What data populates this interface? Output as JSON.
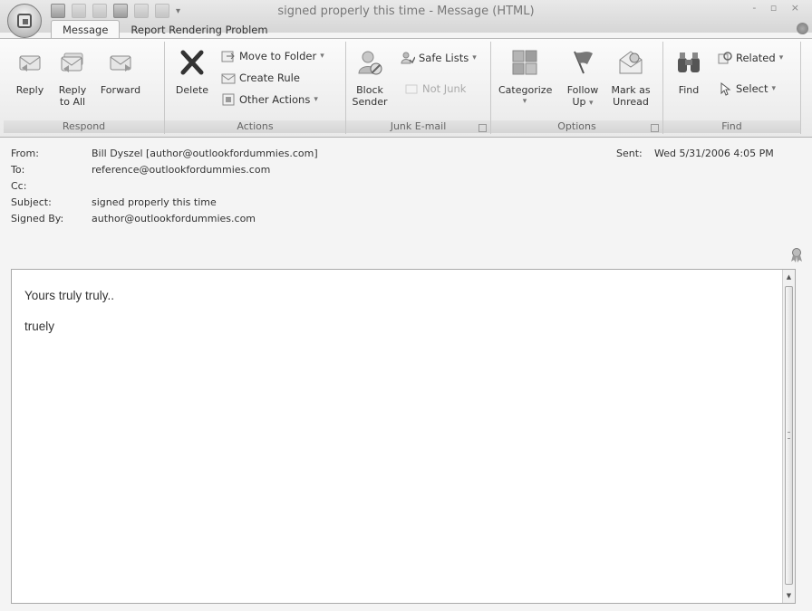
{
  "window": {
    "title": "signed properly this time - Message (HTML)",
    "controls": "- ▫ ×"
  },
  "tabs": [
    {
      "label": "Message"
    },
    {
      "label": "Report Rendering Problem"
    }
  ],
  "ribbon": {
    "respond": {
      "label": "Respond",
      "reply": "Reply",
      "reply_all_1": "Reply",
      "reply_all_2": "to All",
      "forward": "Forward"
    },
    "actions": {
      "label": "Actions",
      "delete": "Delete",
      "move_to_folder": "Move to Folder",
      "create_rule": "Create Rule",
      "other_actions": "Other Actions"
    },
    "junk": {
      "label": "Junk E-mail",
      "block_sender_1": "Block",
      "block_sender_2": "Sender",
      "safe_lists": "Safe Lists",
      "not_junk": "Not Junk"
    },
    "options": {
      "label": "Options",
      "categorize": "Categorize",
      "follow_up_1": "Follow",
      "follow_up_2": "Up",
      "mark_unread_1": "Mark as",
      "mark_unread_2": "Unread"
    },
    "find": {
      "label": "Find",
      "find": "Find",
      "related": "Related",
      "select": "Select"
    }
  },
  "header": {
    "from_label": "From:",
    "from": "Bill Dyszel [author@outlookfordummies.com]",
    "to_label": "To:",
    "to": "reference@outlookfordummies.com",
    "cc_label": "Cc:",
    "cc": "",
    "subject_label": "Subject:",
    "subject": "signed properly this time",
    "signed_by_label": "Signed By:",
    "signed_by": "author@outlookfordummies.com",
    "sent_label": "Sent:",
    "sent": "Wed 5/31/2006 4:05 PM"
  },
  "body": {
    "line1": "Yours truly truly..",
    "line2": "truely"
  },
  "icons": {
    "office": "office-logo-icon",
    "save": "save-icon",
    "signature": "signature-ribbon-icon"
  }
}
